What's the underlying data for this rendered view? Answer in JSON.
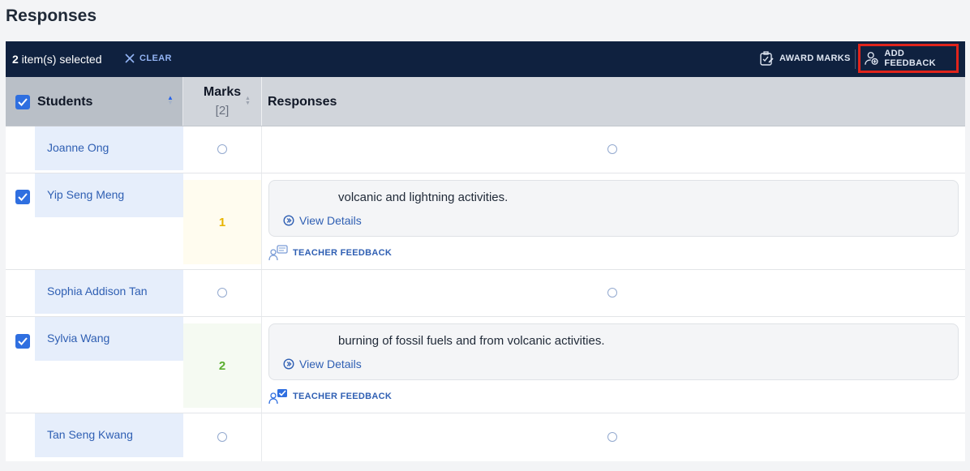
{
  "page": {
    "title": "Responses"
  },
  "selection_bar": {
    "count": "2",
    "selected_text": " item(s) selected",
    "clear_label": "CLEAR",
    "award_marks_label": "AWARD MARKS",
    "add_feedback_label": "ADD FEEDBACK"
  },
  "table": {
    "headers": {
      "students": "Students",
      "marks": "Marks",
      "marks_total": "[2]",
      "responses": "Responses"
    },
    "rows": [
      {
        "name": "Joanne Ong",
        "selected": false,
        "mark": "",
        "response": ""
      },
      {
        "name": "Yip Seng Meng",
        "selected": true,
        "mark": "1",
        "response": "volcanic and lightning activities.",
        "view_details": "View Details",
        "teacher_feedback": "TEACHER FEEDBACK"
      },
      {
        "name": "Sophia Addison Tan",
        "selected": false,
        "mark": "",
        "response": ""
      },
      {
        "name": "Sylvia Wang",
        "selected": true,
        "mark": "2",
        "response": "burning of fossil fuels and from volcanic activities.",
        "view_details": "View Details",
        "teacher_feedback": "TEACHER FEEDBACK"
      },
      {
        "name": "Tan Seng Kwang",
        "selected": false,
        "mark": "",
        "response": ""
      }
    ]
  },
  "colors": {
    "bar_bg": "#0f213f",
    "accent": "#2f6fe0",
    "highlight_box": "#e0241b",
    "mark_partial": "#e8b400",
    "mark_full": "#5aae2e"
  }
}
